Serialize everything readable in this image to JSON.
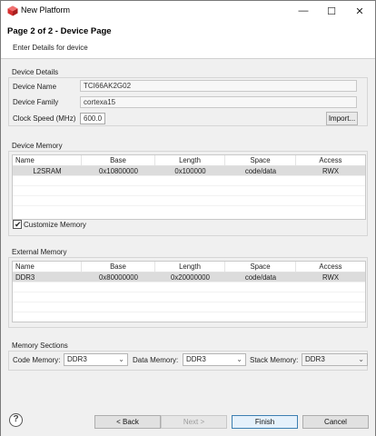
{
  "window": {
    "title": "New Platform",
    "min_glyph": "—",
    "max_glyph": "☐",
    "close_glyph": "✕"
  },
  "header": {
    "title": "Page 2 of 2 - Device Page",
    "subtitle": "Enter Details for device"
  },
  "device_details": {
    "group_label": "Device Details",
    "name_label": "Device Name",
    "name_value": "TCI66AK2G02",
    "family_label": "Device Family",
    "family_value": "cortexa15",
    "clock_label": "Clock Speed (MHz)",
    "clock_value": "600.0",
    "import_label": "Import..."
  },
  "device_memory": {
    "group_label": "Device Memory",
    "columns": [
      "Name",
      "Base",
      "Length",
      "Space",
      "Access"
    ],
    "rows": [
      {
        "name": "L2SRAM",
        "base": "0x10800000",
        "length": "0x100000",
        "space": "code/data",
        "access": "RWX"
      }
    ],
    "customize_label": "Customize Memory",
    "customize_checked": true,
    "check_glyph": "✔"
  },
  "external_memory": {
    "group_label": "External Memory",
    "columns": [
      "Name",
      "Base",
      "Length",
      "Space",
      "Access"
    ],
    "rows": [
      {
        "name": "DDR3",
        "base": "0x80000000",
        "length": "0x20000000",
        "space": "code/data",
        "access": "RWX"
      }
    ]
  },
  "memory_sections": {
    "group_label": "Memory Sections",
    "code_label": "Code Memory:",
    "code_value": "DDR3",
    "data_label": "Data Memory:",
    "data_value": "DDR3",
    "stack_label": "Stack Memory:",
    "stack_value": "DDR3",
    "arrow_glyph": "⌄"
  },
  "footer": {
    "help_glyph": "?",
    "back_label": "< Back",
    "next_label": "Next >",
    "finish_label": "Finish",
    "cancel_label": "Cancel"
  },
  "colors": {
    "accent": "#3c7fb1",
    "app_icon": "#d62f2f",
    "selected_row": "#dcdcdc"
  }
}
